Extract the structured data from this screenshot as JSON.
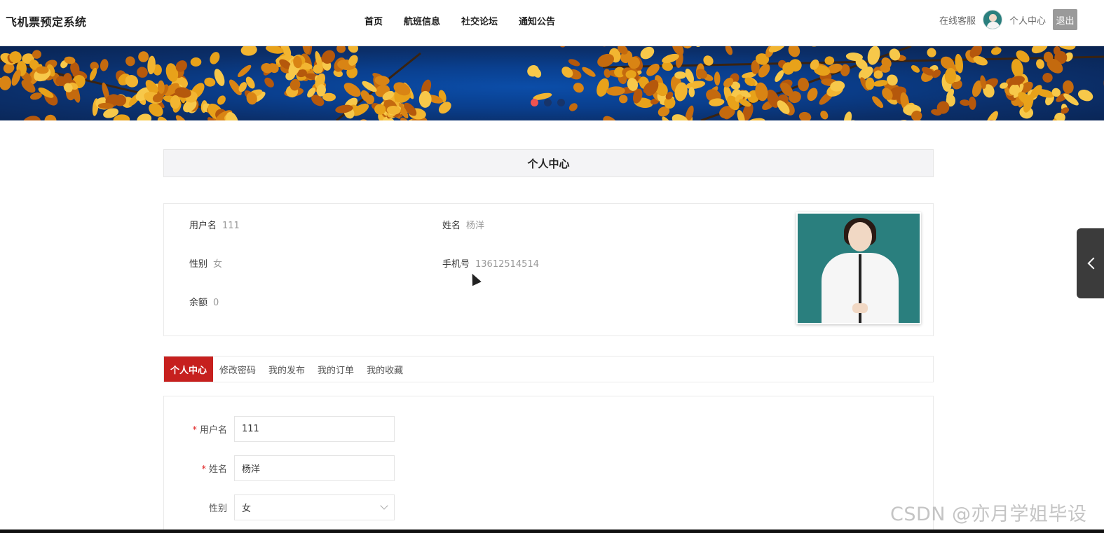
{
  "site": {
    "title": "飞机票预定系统"
  },
  "nav": {
    "items": [
      "首页",
      "航班信息",
      "社交论坛",
      "通知公告"
    ]
  },
  "header_tools": {
    "service": "在线客服",
    "user_center": "个人中心",
    "logout": "退出"
  },
  "banner": {
    "slide_count": 3,
    "active_slide": 1,
    "active_color": "#ef5350",
    "inactive_color": "#17346a"
  },
  "section": {
    "title": "个人中心"
  },
  "profile": {
    "username_label": "用户名",
    "username": "111",
    "name_label": "姓名",
    "name": "杨洋",
    "gender_label": "性别",
    "gender": "女",
    "phone_label": "手机号",
    "phone": "13612514514",
    "balance_label": "余额",
    "balance": "0"
  },
  "tabs": [
    "个人中心",
    "修改密码",
    "我的发布",
    "我的订单",
    "我的收藏"
  ],
  "form": {
    "username_label": "用户名",
    "username_value": "111",
    "name_label": "姓名",
    "name_value": "杨洋",
    "gender_label": "性别",
    "gender_value": "女"
  },
  "colors": {
    "accent": "#c6201e",
    "required": "#e02020"
  },
  "watermark": "CSDN @亦月学姐毕设"
}
